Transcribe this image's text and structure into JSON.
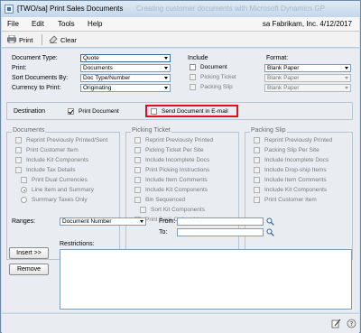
{
  "window": {
    "title": "[TWO/sa] Print Sales Documents",
    "background_title": "Creating customer documents with Microsoft Dynamics GP"
  },
  "menu": {
    "items": [
      "File",
      "Edit",
      "Tools",
      "Help"
    ],
    "company_info": "sa  Fabrikam, Inc.  4/12/2017"
  },
  "toolbar": {
    "print_label": "Print",
    "clear_label": "Clear"
  },
  "form": {
    "document_type": {
      "label": "Document Type:",
      "value": "Quote"
    },
    "print": {
      "label": "Print:",
      "value": "Documents"
    },
    "sort_by": {
      "label": "Sort Documents By:",
      "value": "Doc Type/Number"
    },
    "currency": {
      "label": "Currency to Print:",
      "value": "Originating"
    }
  },
  "include": {
    "label": "Include",
    "items": [
      {
        "label": "Document",
        "checked": false
      },
      {
        "label": "Picking Ticket",
        "checked": false
      },
      {
        "label": "Packing Slip",
        "checked": false
      }
    ]
  },
  "format": {
    "label": "Format:",
    "values": [
      "Blank Paper",
      "Blank Paper",
      "Blank Paper"
    ]
  },
  "destination": {
    "label": "Destination",
    "print_document": {
      "label": "Print Document",
      "checked": true
    },
    "send_email": {
      "label": "Send Document in E-mail",
      "checked": false
    }
  },
  "documents_group": {
    "title": "Documents",
    "items": [
      "Reprint Previously Printed/Sent",
      "Print Customer Item",
      "Include Kit Components",
      "Include Tax Details",
      "Print Dual Currencies"
    ],
    "radios": [
      "Line Item and Summary",
      "Summary Taxes Only"
    ]
  },
  "picking_group": {
    "title": "Picking Ticket",
    "items": [
      "Reprint Previously Printed",
      "Picking Ticket Per Site",
      "Include Incomplete Docs",
      "Print Picking Instructions",
      "Include Item Comments",
      "Include Kit Components",
      "Bin Sequenced",
      "Sort Kit Components",
      "Print Back Ordered Items"
    ]
  },
  "packing_group": {
    "title": "Packing Slip",
    "items": [
      "Reprint Previously Printed",
      "Packing Slip Per Site",
      "Include Incomplete Docs",
      "Include Drop-ship Items",
      "Include Item Comments",
      "Include Kit Components",
      "Print Customer Item"
    ]
  },
  "ranges": {
    "label": "Ranges:",
    "value": "Document Number",
    "from_label": "From:",
    "to_label": "To:",
    "insert_label": "Insert >>",
    "remove_label": "Remove",
    "restrictions_label": "Restrictions:"
  }
}
